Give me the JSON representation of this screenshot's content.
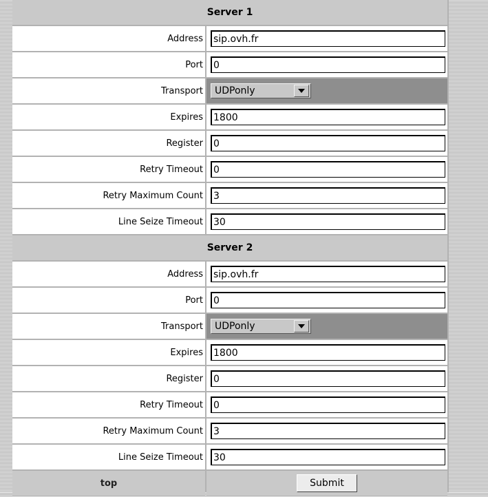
{
  "servers": [
    {
      "title": "Server 1",
      "fields": {
        "address": {
          "label": "Address",
          "value": "sip.ovh.fr"
        },
        "port": {
          "label": "Port",
          "value": "0"
        },
        "transport": {
          "label": "Transport",
          "value": "UDPonly"
        },
        "expires": {
          "label": "Expires",
          "value": "1800"
        },
        "register": {
          "label": "Register",
          "value": "0"
        },
        "retry_timeout": {
          "label": "Retry Timeout",
          "value": "0"
        },
        "retry_max": {
          "label": "Retry Maximum Count",
          "value": "3"
        },
        "line_seize": {
          "label": "Line Seize Timeout",
          "value": "30"
        }
      }
    },
    {
      "title": "Server 2",
      "fields": {
        "address": {
          "label": "Address",
          "value": "sip.ovh.fr"
        },
        "port": {
          "label": "Port",
          "value": "0"
        },
        "transport": {
          "label": "Transport",
          "value": "UDPonly"
        },
        "expires": {
          "label": "Expires",
          "value": "1800"
        },
        "register": {
          "label": "Register",
          "value": "0"
        },
        "retry_timeout": {
          "label": "Retry Timeout",
          "value": "0"
        },
        "retry_max": {
          "label": "Retry Maximum Count",
          "value": "3"
        },
        "line_seize": {
          "label": "Line Seize Timeout",
          "value": "30"
        }
      }
    }
  ],
  "footer": {
    "top_link": "top",
    "submit_label": "Submit"
  },
  "icons": {
    "select_arrow": "chevron-down-icon"
  }
}
